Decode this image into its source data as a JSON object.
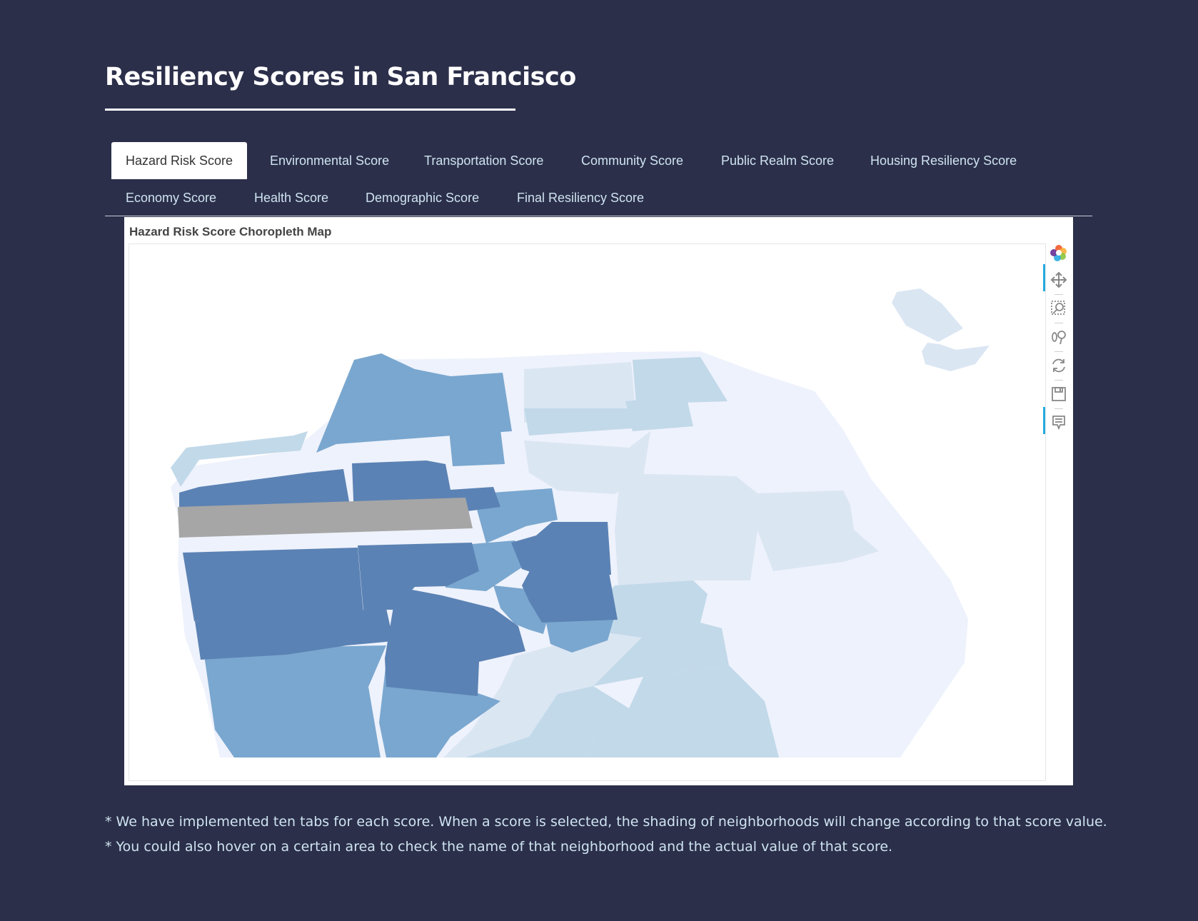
{
  "page": {
    "title": "Resiliency Scores in San Francisco"
  },
  "tabs": [
    {
      "label": "Hazard Risk Score",
      "active": true
    },
    {
      "label": "Environmental Score",
      "active": false
    },
    {
      "label": "Transportation Score",
      "active": false
    },
    {
      "label": "Community Score",
      "active": false
    },
    {
      "label": "Public Realm Score",
      "active": false
    },
    {
      "label": "Housing Resiliency Score",
      "active": false
    },
    {
      "label": "Economy Score",
      "active": false
    },
    {
      "label": "Health Score",
      "active": false
    },
    {
      "label": "Demographic Score",
      "active": false
    },
    {
      "label": "Final Resiliency Score",
      "active": false
    }
  ],
  "map": {
    "title": "Hazard Risk Score Choropleth Map",
    "palette": {
      "highest": "#5b82b4",
      "high": "#7aa7cf",
      "medium": "#c2d9e9",
      "low": "#dbe6f3",
      "lowest": "#eef2fc",
      "no_data": "#a6a6a6"
    },
    "toolbar": [
      {
        "icon": "bokeh-logo-icon",
        "active": false
      },
      {
        "icon": "pan-icon",
        "active": true
      },
      {
        "icon": "box-zoom-icon",
        "active": false
      },
      {
        "icon": "wheel-zoom-icon",
        "active": false
      },
      {
        "icon": "reset-icon",
        "active": false
      },
      {
        "icon": "save-icon",
        "active": false
      },
      {
        "icon": "hover-icon",
        "active": true
      }
    ]
  },
  "notes": [
    "* We have implemented ten tabs for each score. When a score is selected, the shading of neighborhoods will change according to that score value.",
    "* You could also hover on a certain area to check the name of that neighborhood and the actual value of that score."
  ]
}
